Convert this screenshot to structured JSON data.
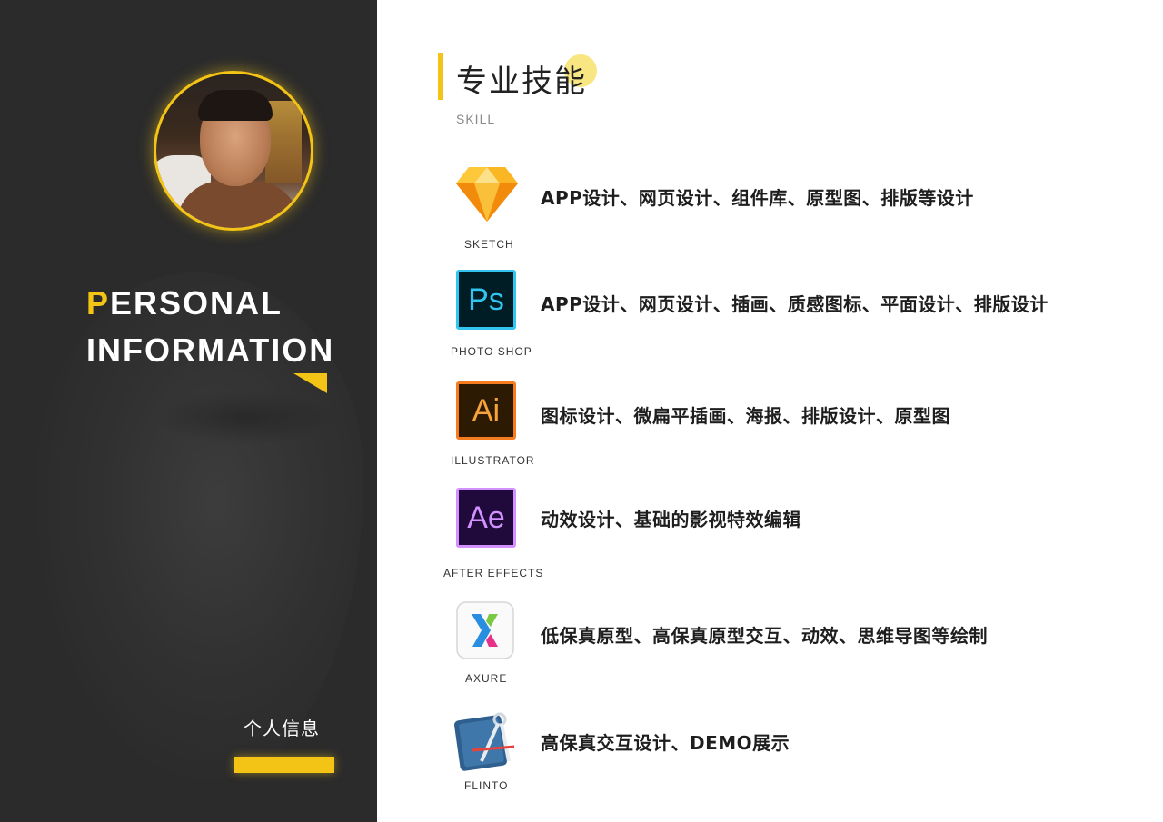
{
  "colors": {
    "accent": "#f3c316",
    "panel_bg": "#2b2b2b",
    "text_dark": "#1e1e1e",
    "subtitle_gray": "#8a8a8a"
  },
  "left": {
    "title_first_letter": "P",
    "title_line1_rest": "ERSONAL",
    "title_line2": "INFORMATION",
    "personal_cn": "个人信息"
  },
  "section": {
    "title": "专业技能",
    "subtitle": "SKILL"
  },
  "skills": [
    {
      "icon": "sketch-icon",
      "tool": "SKETCH",
      "desc": "APP设计、网页设计、组件库、原型图、排版等设计"
    },
    {
      "icon": "photoshop-icon",
      "icon_text": "Ps",
      "tool": "PHOTO SHOP",
      "desc": "APP设计、网页设计、插画、质感图标、平面设计、排版设计"
    },
    {
      "icon": "illustrator-icon",
      "icon_text": "Ai",
      "tool": "ILLUSTRATOR",
      "desc": "图标设计、微扁平插画、海报、排版设计、原型图"
    },
    {
      "icon": "after-effects-icon",
      "icon_text": "Ae",
      "tool": "AFTER EFFECTS",
      "desc": "动效设计、基础的影视特效编辑"
    },
    {
      "icon": "axure-icon",
      "tool": "AXURE",
      "desc": "低保真原型、高保真原型交互、动效、思维导图等绘制"
    },
    {
      "icon": "flinto-icon",
      "tool": "FLINTO",
      "desc": "高保真交互设计、DEMO展示"
    }
  ]
}
